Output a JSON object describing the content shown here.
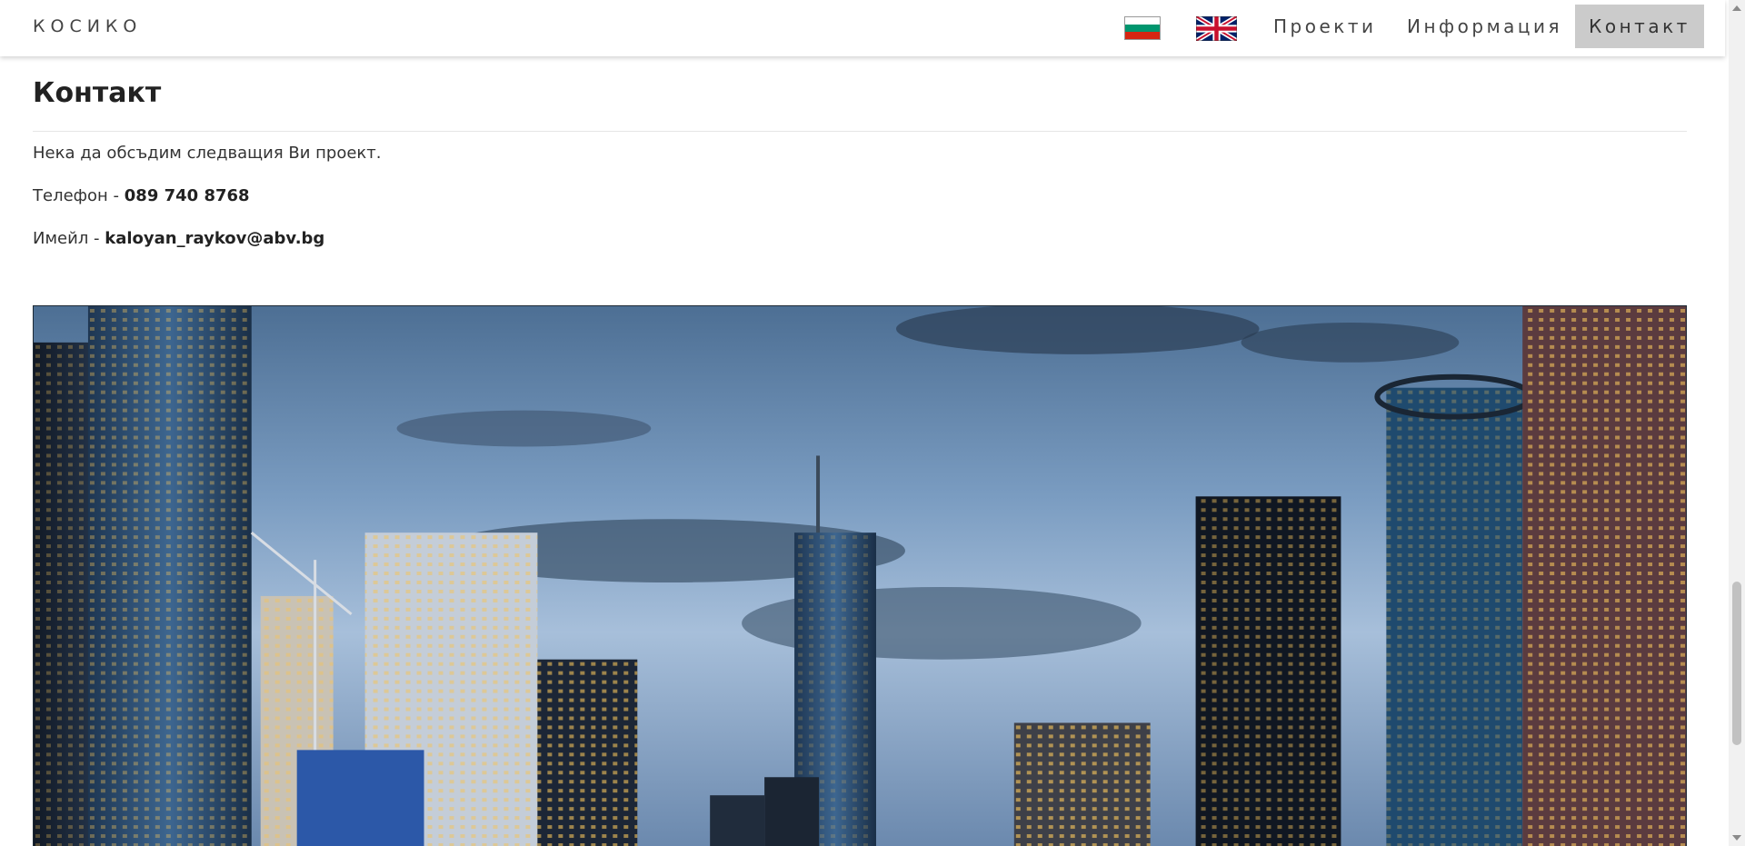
{
  "header": {
    "brand": "КОСИКО",
    "flags": [
      {
        "name": "bulgarian-flag",
        "colors": [
          "#ffffff",
          "#00966e",
          "#d62612"
        ]
      },
      {
        "name": "uk-flag",
        "colors": [
          "#012169",
          "#ffffff",
          "#c8102e"
        ]
      }
    ],
    "nav": [
      {
        "label": "Проекти",
        "active": false
      },
      {
        "label": "Информация",
        "active": false
      },
      {
        "label": "Контакт",
        "active": true
      }
    ],
    "active_color": "#cbcbcb"
  },
  "contact": {
    "title": "Контакт",
    "intro": "Нека да обсъдим следващия Ви проект.",
    "phone_label": "Телефон - ",
    "phone_value": "089 740 8768",
    "email_label": "Имейл - ",
    "email_value": "kaloyan_raykov@abv.bg"
  },
  "hero_image": {
    "subject": "city skyline at dusk"
  }
}
